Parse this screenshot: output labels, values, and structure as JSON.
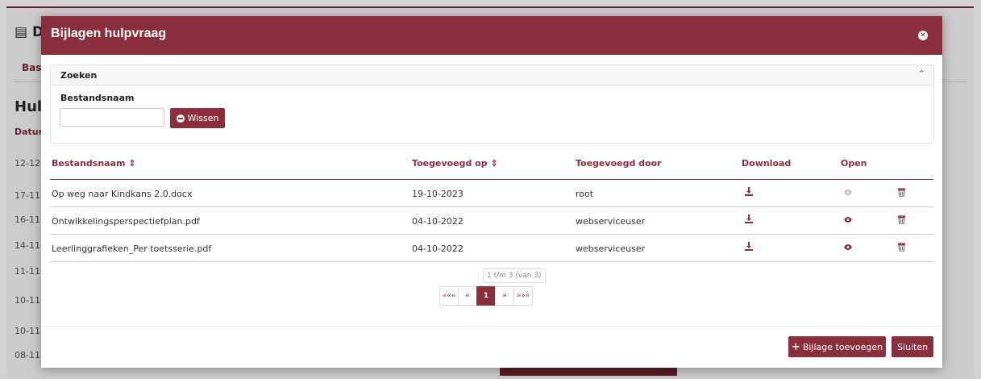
{
  "background": {
    "title": "D",
    "tab": "Basis",
    "heading": "Hulp",
    "column": "Datum",
    "rows": [
      "12-12-",
      "17-11-",
      "16-11-",
      "14-11-",
      "11-11-",
      "10-11-",
      "10-11-",
      "08-11-"
    ]
  },
  "modal": {
    "title": "Bijlagen hulpvraag",
    "search": {
      "title": "Zoeken",
      "field_label": "Bestandsnaam",
      "value": "",
      "clear_label": "Wissen"
    },
    "table": {
      "headers": {
        "filename": "Bestandsnaam ⇕",
        "added_on": "Toegevoegd op ⇕",
        "added_by": "Toegevoegd door",
        "download": "Download",
        "open": "Open"
      },
      "rows": [
        {
          "filename": "Op weg naar Kindkans 2.0.docx",
          "added_on": "19-10-2023",
          "added_by": "root"
        },
        {
          "filename": "Ontwikkelingsperspectiefplan.pdf",
          "added_on": "04-10-2022",
          "added_by": "webserviceuser"
        },
        {
          "filename": "Leerlinggrafieken_Per toetsserie.pdf",
          "added_on": "04-10-2022",
          "added_by": "webserviceuser"
        }
      ]
    },
    "pagination": {
      "info": "1 t/m 3 (van 3)",
      "first": "«««",
      "prev": "«",
      "current": "1",
      "next": "»",
      "last": "»»»"
    },
    "footer": {
      "add_label": "Bijlage toevoegen",
      "close_label": "Sluiten"
    }
  },
  "colors": {
    "primary": "#8a2f3b"
  }
}
